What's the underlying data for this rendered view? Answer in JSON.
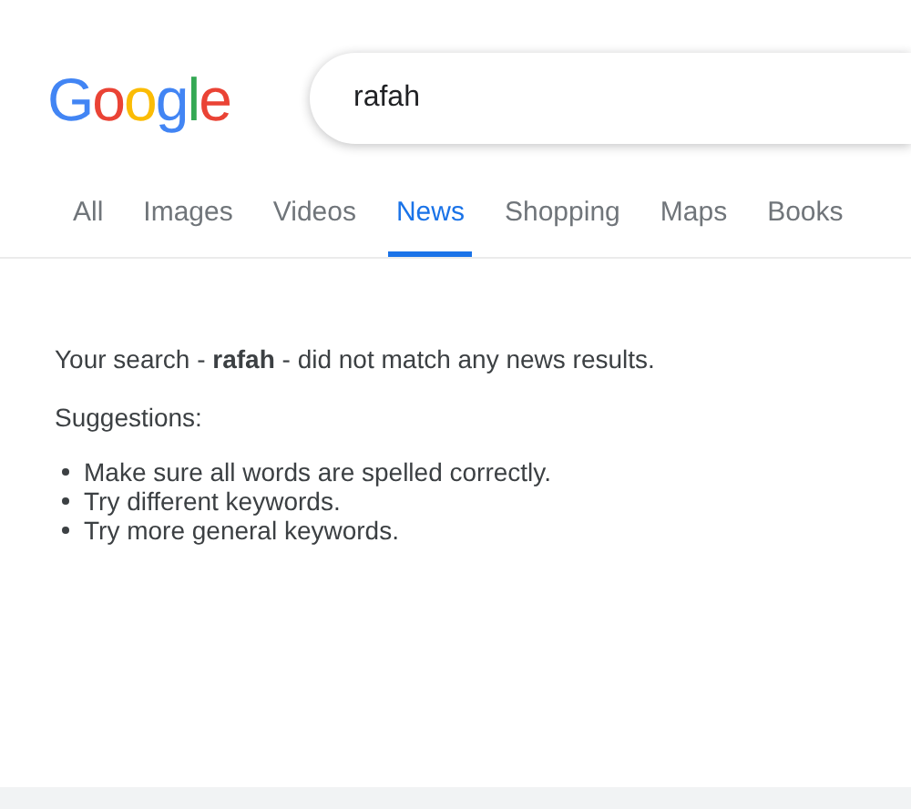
{
  "logo": "Google",
  "search": {
    "value": "rafah"
  },
  "tabs": [
    {
      "label": "All",
      "selected": false
    },
    {
      "label": "Images",
      "selected": false
    },
    {
      "label": "Videos",
      "selected": false
    },
    {
      "label": "News",
      "selected": true
    },
    {
      "label": "Shopping",
      "selected": false
    },
    {
      "label": "Maps",
      "selected": false
    },
    {
      "label": "Books",
      "selected": false
    }
  ],
  "message": "Your search - **rafah** - did not match any news results.",
  "suggestions_heading": "Suggestions:",
  "suggestions": [
    "Make sure all words are spelled correctly.",
    "Try different keywords.",
    "Try more general keywords."
  ]
}
